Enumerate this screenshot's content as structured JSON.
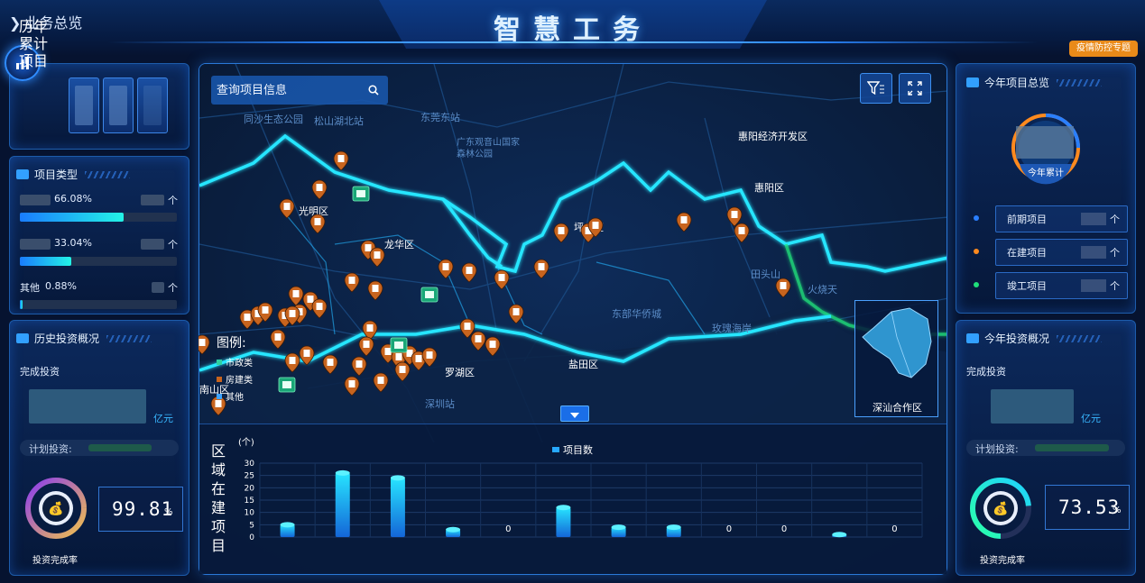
{
  "header": {
    "title": "智慧工务",
    "back_label": "业务总览",
    "special_button": "疫情防控专题"
  },
  "left": {
    "history": {
      "label": "历年累计项目"
    },
    "project_type": {
      "title": "项目类型",
      "rows": [
        {
          "name": "",
          "percent": "66.08%",
          "unit": "个",
          "fill": 0.66
        },
        {
          "name": "",
          "percent": "33.04%",
          "unit": "个",
          "fill": 0.33
        },
        {
          "name": "其他",
          "percent": "0.88%",
          "unit": "个",
          "fill": 0.009
        }
      ]
    },
    "invest": {
      "title": "历史投资概况",
      "done_label": "完成投资",
      "unit": "亿元",
      "plan_label": "计划投资:",
      "rate_value": "99.81",
      "rate_unit": "%",
      "rate_fraction": 0.998,
      "rate_label": "投资完成率"
    }
  },
  "right": {
    "year_overview": {
      "title": "今年项目总览",
      "ring_label": "今年累计",
      "items": [
        {
          "label": "前期项目",
          "unit": "个",
          "color": "#2a7fff"
        },
        {
          "label": "在建项目",
          "unit": "个",
          "color": "#ff8a1e"
        },
        {
          "label": "竣工项目",
          "unit": "个",
          "color": "#1fe07a"
        }
      ]
    },
    "invest": {
      "title": "今年投资概况",
      "done_label": "完成投资",
      "unit": "亿元",
      "plan_label": "计划投资:",
      "rate_value": "73.53",
      "rate_unit": "%",
      "rate_fraction": 0.735,
      "rate_label": "投资完成率"
    }
  },
  "map": {
    "search_placeholder": "查询项目信息",
    "legend_title": "图例:",
    "legend_items": [
      "市政类",
      "房建类",
      "其他"
    ],
    "inset_label": "深汕合作区",
    "place_labels": [
      "光明区",
      "龙华区",
      "罗湖区",
      "惠阳经济开发区",
      "惠阳区",
      "坪山区",
      "盐田区",
      "深圳站",
      "东莞东站",
      "松山湖北站",
      "同沙生态公园",
      "广东观音山国家森林公园",
      "玫瑰海岸",
      "南山区",
      "田头山",
      "火烧天",
      "东部华侨城"
    ]
  },
  "chart_data": {
    "type": "bar",
    "title": "区域在建项目",
    "ylabel": "(个)",
    "legend": "项目数",
    "ylim": [
      0,
      30
    ],
    "yticks": [
      0,
      5,
      10,
      15,
      20,
      25,
      30
    ],
    "categories": [
      "",
      "",
      "",
      "",
      "",
      "",
      "",
      "",
      "",
      "",
      "",
      ""
    ],
    "values": [
      5,
      26,
      24,
      3,
      0,
      12,
      4,
      4,
      0,
      0,
      1,
      0
    ],
    "value_labels": [
      "",
      "",
      "",
      "",
      "0",
      "",
      "",
      "",
      "0",
      "0",
      "",
      "0"
    ]
  },
  "colors": {
    "accent": "#2a86ff",
    "bar_top": "#27e4ff",
    "bar_bottom": "#1466d8",
    "orange": "#e98a19",
    "map_border": "#27e6ff",
    "pin": "#c8641e"
  }
}
